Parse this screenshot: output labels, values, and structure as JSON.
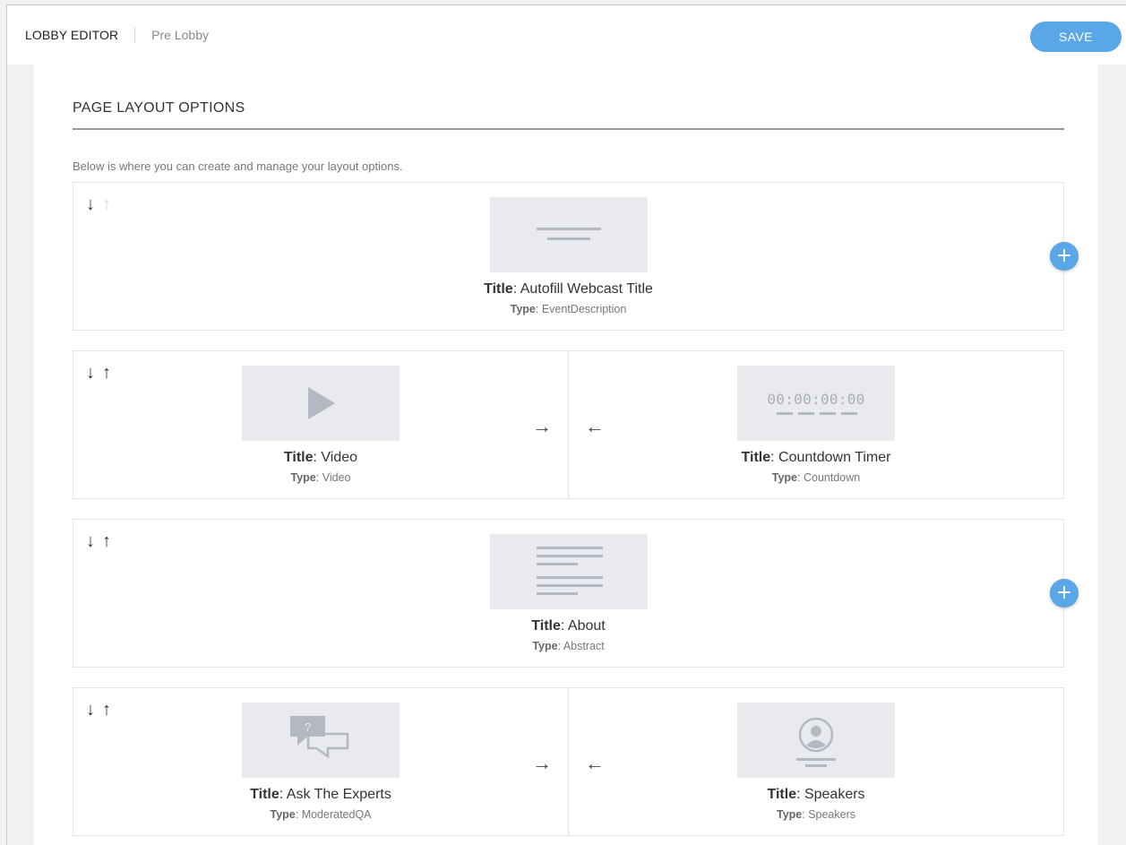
{
  "header": {
    "app_title": "LOBBY EDITOR",
    "sub_title": "Pre Lobby",
    "save_label": "SAVE"
  },
  "section": {
    "title": "PAGE LAYOUT OPTIONS",
    "description": "Below is where you can create and manage your layout options."
  },
  "labels": {
    "title_prefix": "Title",
    "type_prefix": "Type",
    "arrow_down": "↓",
    "arrow_up": "↑",
    "arrow_right": "→",
    "arrow_left": "←",
    "add": "+"
  },
  "rows": [
    {
      "widgets": [
        {
          "title": "Autofill Webcast Title",
          "type": "EventDescription",
          "icon": "title-lines-icon"
        }
      ],
      "up_disabled": true
    },
    {
      "widgets": [
        {
          "title": "Video",
          "type": "Video",
          "icon": "play-icon"
        },
        {
          "title": "Countdown Timer",
          "type": "Countdown",
          "icon": "countdown-timer-icon",
          "timer_text": "00:00:00:00"
        }
      ],
      "up_disabled": false
    },
    {
      "widgets": [
        {
          "title": "About",
          "type": "Abstract",
          "icon": "text-paragraph-icon"
        }
      ],
      "up_disabled": false
    },
    {
      "widgets": [
        {
          "title": "Ask The Experts",
          "type": "ModeratedQA",
          "icon": "chat-bubbles-icon"
        },
        {
          "title": "Speakers",
          "type": "Speakers",
          "icon": "speaker-avatar-icon"
        }
      ],
      "up_disabled": false
    }
  ],
  "colors": {
    "accent": "#5aa7e8",
    "placeholder_bg": "#e8eaed",
    "placeholder_fg": "#b3b8c2"
  }
}
